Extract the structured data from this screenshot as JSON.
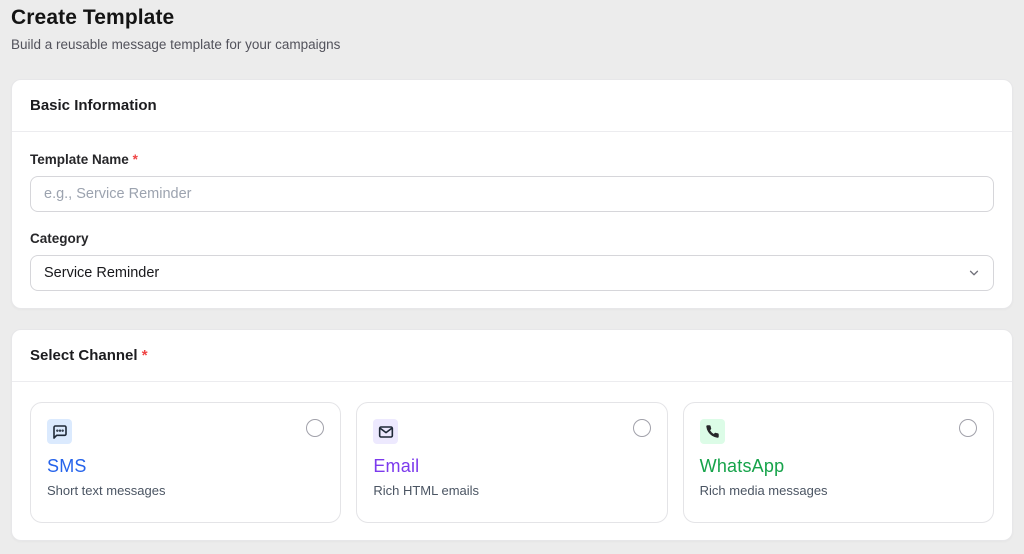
{
  "page": {
    "title": "Create Template",
    "subtitle": "Build a reusable message template for your campaigns"
  },
  "basic_info": {
    "heading": "Basic Information",
    "template_name": {
      "label": "Template Name",
      "required_marker": "*",
      "value": "",
      "placeholder": "e.g., Service Reminder"
    },
    "category": {
      "label": "Category",
      "selected": "Service Reminder"
    }
  },
  "channels": {
    "heading": "Select Channel",
    "required_marker": "*",
    "options": [
      {
        "id": "sms",
        "name": "SMS",
        "description": "Short text messages",
        "icon": "message-bubble-icon",
        "accent_color": "#2563eb",
        "icon_bg_color": "#dbeafe",
        "selected": false
      },
      {
        "id": "email",
        "name": "Email",
        "description": "Rich HTML emails",
        "icon": "envelope-icon",
        "accent_color": "#7c3aed",
        "icon_bg_color": "#ede9fe",
        "selected": false
      },
      {
        "id": "whatsapp",
        "name": "WhatsApp",
        "description": "Rich media messages",
        "icon": "phone-icon",
        "accent_color": "#16a34a",
        "icon_bg_color": "#dcfce7",
        "selected": false
      }
    ]
  }
}
